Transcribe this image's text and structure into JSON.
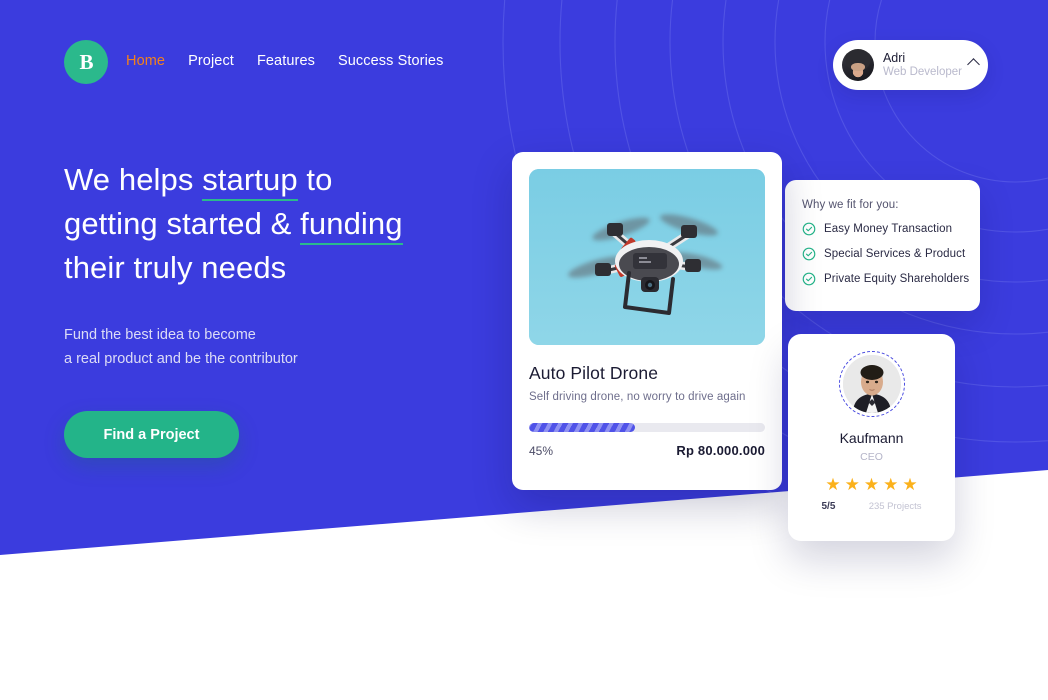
{
  "colors": {
    "brand_blue": "#3B3CDE",
    "brand_green": "#23B489",
    "accent_orange": "#F2811D",
    "star_gold": "#FBB11B"
  },
  "header": {
    "logo_letter": "B",
    "logo_icon": "brand-b-logo",
    "nav": [
      {
        "label": "Home",
        "active": true
      },
      {
        "label": "Project",
        "active": false
      },
      {
        "label": "Features",
        "active": false
      },
      {
        "label": "Success Stories",
        "active": false
      }
    ],
    "profile": {
      "name": "Adri",
      "role": "Web Developer",
      "avatar_icon": "user-avatar",
      "chevron_icon": "chevron-up-icon"
    }
  },
  "hero": {
    "headline_line1_a": "We helps ",
    "headline_line1_em": "startup",
    "headline_line1_b": " to",
    "headline_line2_a": "getting started & ",
    "headline_line2_em": "funding",
    "headline_line3": "their truly needs",
    "sub_line1": "Fund the best idea to become",
    "sub_line2": "a real product and be the contributor",
    "cta_label": "Find a Project"
  },
  "project_card": {
    "photo_icon": "drone-photo",
    "title": "Auto Pilot Drone",
    "description": "Self driving drone, no worry to drive again",
    "progress_percent": 45,
    "progress_label": "45%",
    "amount": "Rp 80.000.000"
  },
  "benefits_card": {
    "title": "Why we fit for you:",
    "items": [
      {
        "label": "Easy Money Transaction",
        "icon": "check-circle-icon"
      },
      {
        "label": "Special Services & Product",
        "icon": "check-circle-icon"
      },
      {
        "label": "Private Equity Shareholders",
        "icon": "check-circle-icon"
      }
    ]
  },
  "testimonial_card": {
    "avatar_icon": "person-portrait",
    "name": "Kaufmann",
    "role": "CEO",
    "stars": 5,
    "star_glyph": "★",
    "rating": "5/5",
    "projects": "235 Projects"
  }
}
